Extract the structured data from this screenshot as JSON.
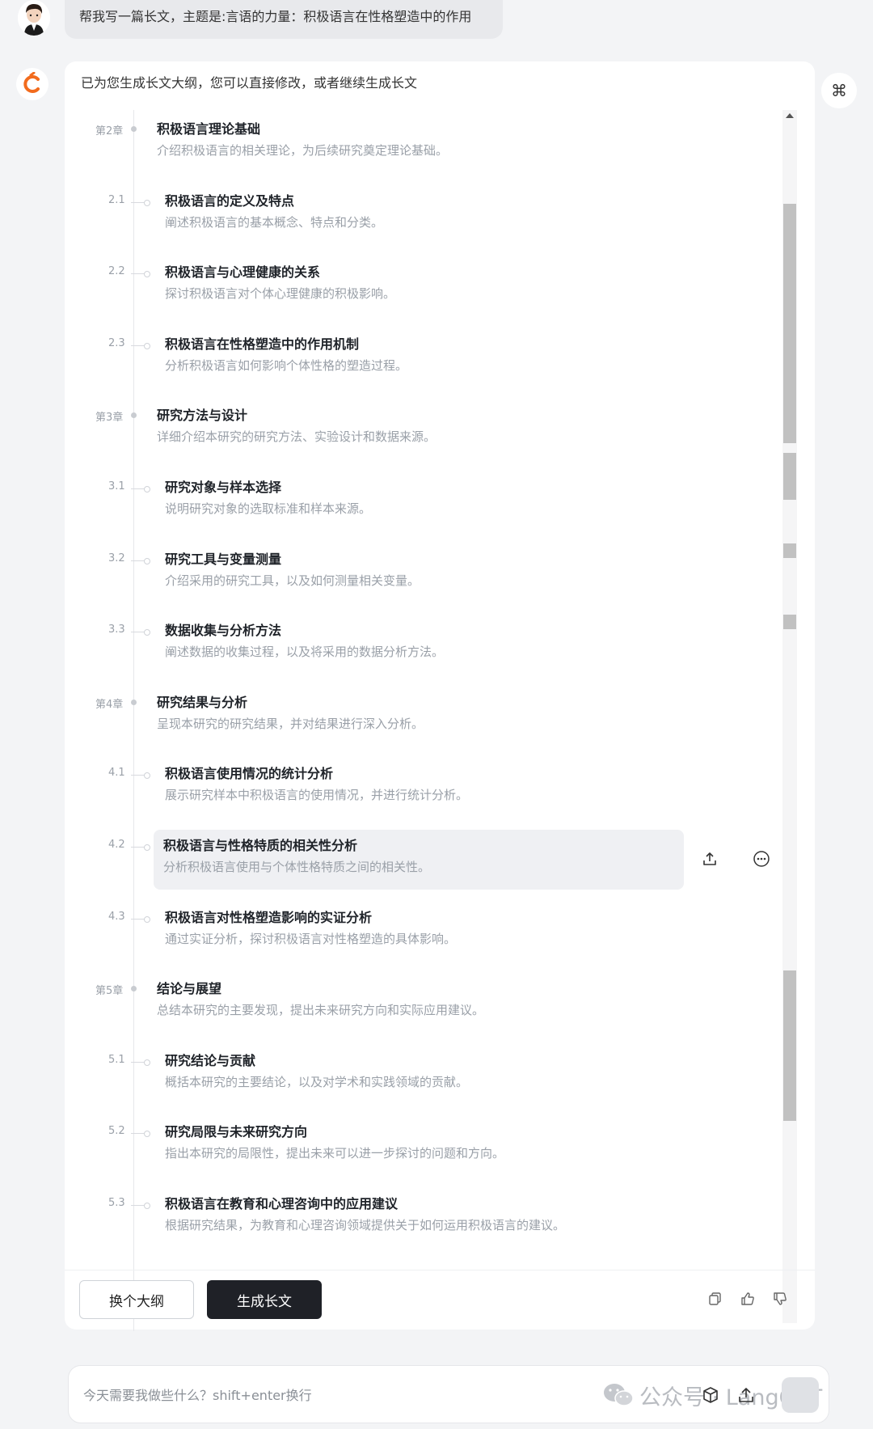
{
  "user_message": "帮我写一篇长文，主题是:言语的力量：积极语言在性格塑造中的作用",
  "assistant_intro": "已为您生成长文大纲，您可以直接修改，或者继续生成长文",
  "outline": [
    {
      "num": "第2章",
      "type": "chapter",
      "title": "积极语言理论基础",
      "desc": "介绍积极语言的相关理论，为后续研究奠定理论基础。"
    },
    {
      "num": "2.1",
      "type": "section",
      "title": "积极语言的定义及特点",
      "desc": "阐述积极语言的基本概念、特点和分类。"
    },
    {
      "num": "2.2",
      "type": "section",
      "title": "积极语言与心理健康的关系",
      "desc": "探讨积极语言对个体心理健康的积极影响。"
    },
    {
      "num": "2.3",
      "type": "section",
      "title": "积极语言在性格塑造中的作用机制",
      "desc": "分析积极语言如何影响个体性格的塑造过程。"
    },
    {
      "num": "第3章",
      "type": "chapter",
      "title": "研究方法与设计",
      "desc": "详细介绍本研究的研究方法、实验设计和数据来源。"
    },
    {
      "num": "3.1",
      "type": "section",
      "title": "研究对象与样本选择",
      "desc": "说明研究对象的选取标准和样本来源。"
    },
    {
      "num": "3.2",
      "type": "section",
      "title": "研究工具与变量测量",
      "desc": "介绍采用的研究工具，以及如何测量相关变量。"
    },
    {
      "num": "3.3",
      "type": "section",
      "title": "数据收集与分析方法",
      "desc": "阐述数据的收集过程，以及将采用的数据分析方法。"
    },
    {
      "num": "第4章",
      "type": "chapter",
      "title": "研究结果与分析",
      "desc": "呈现本研究的研究结果，并对结果进行深入分析。"
    },
    {
      "num": "4.1",
      "type": "section",
      "title": "积极语言使用情况的统计分析",
      "desc": "展示研究样本中积极语言的使用情况，并进行统计分析。"
    },
    {
      "num": "4.2",
      "type": "section",
      "title": "积极语言与性格特质的相关性分析",
      "desc": "分析积极语言使用与个体性格特质之间的相关性。"
    },
    {
      "num": "4.3",
      "type": "section",
      "title": "积极语言对性格塑造影响的实证分析",
      "desc": "通过实证分析，探讨积极语言对性格塑造的具体影响。"
    },
    {
      "num": "第5章",
      "type": "chapter",
      "title": "结论与展望",
      "desc": "总结本研究的主要发现，提出未来研究方向和实际应用建议。"
    },
    {
      "num": "5.1",
      "type": "section",
      "title": "研究结论与贡献",
      "desc": "概括本研究的主要结论，以及对学术和实践领域的贡献。"
    },
    {
      "num": "5.2",
      "type": "section",
      "title": "研究局限与未来研究方向",
      "desc": "指出本研究的局限性，提出未来可以进一步探讨的问题和方向。"
    },
    {
      "num": "5.3",
      "type": "section",
      "title": "积极语言在教育和心理咨询中的应用建议",
      "desc": "根据研究结果，为教育和心理咨询领域提供关于如何运用积极语言的建议。"
    }
  ],
  "active_index": 10,
  "buttons": {
    "change_outline": "换个大纲",
    "generate": "生成长文"
  },
  "input": {
    "placeholder": "今天需要我做些什么？shift+enter换行"
  },
  "watermark": "公众号 · LangGPT",
  "colors": {
    "primary_dark": "#1f2127",
    "brand_orange": "#f26b1d",
    "background": "#f3f4f6"
  }
}
